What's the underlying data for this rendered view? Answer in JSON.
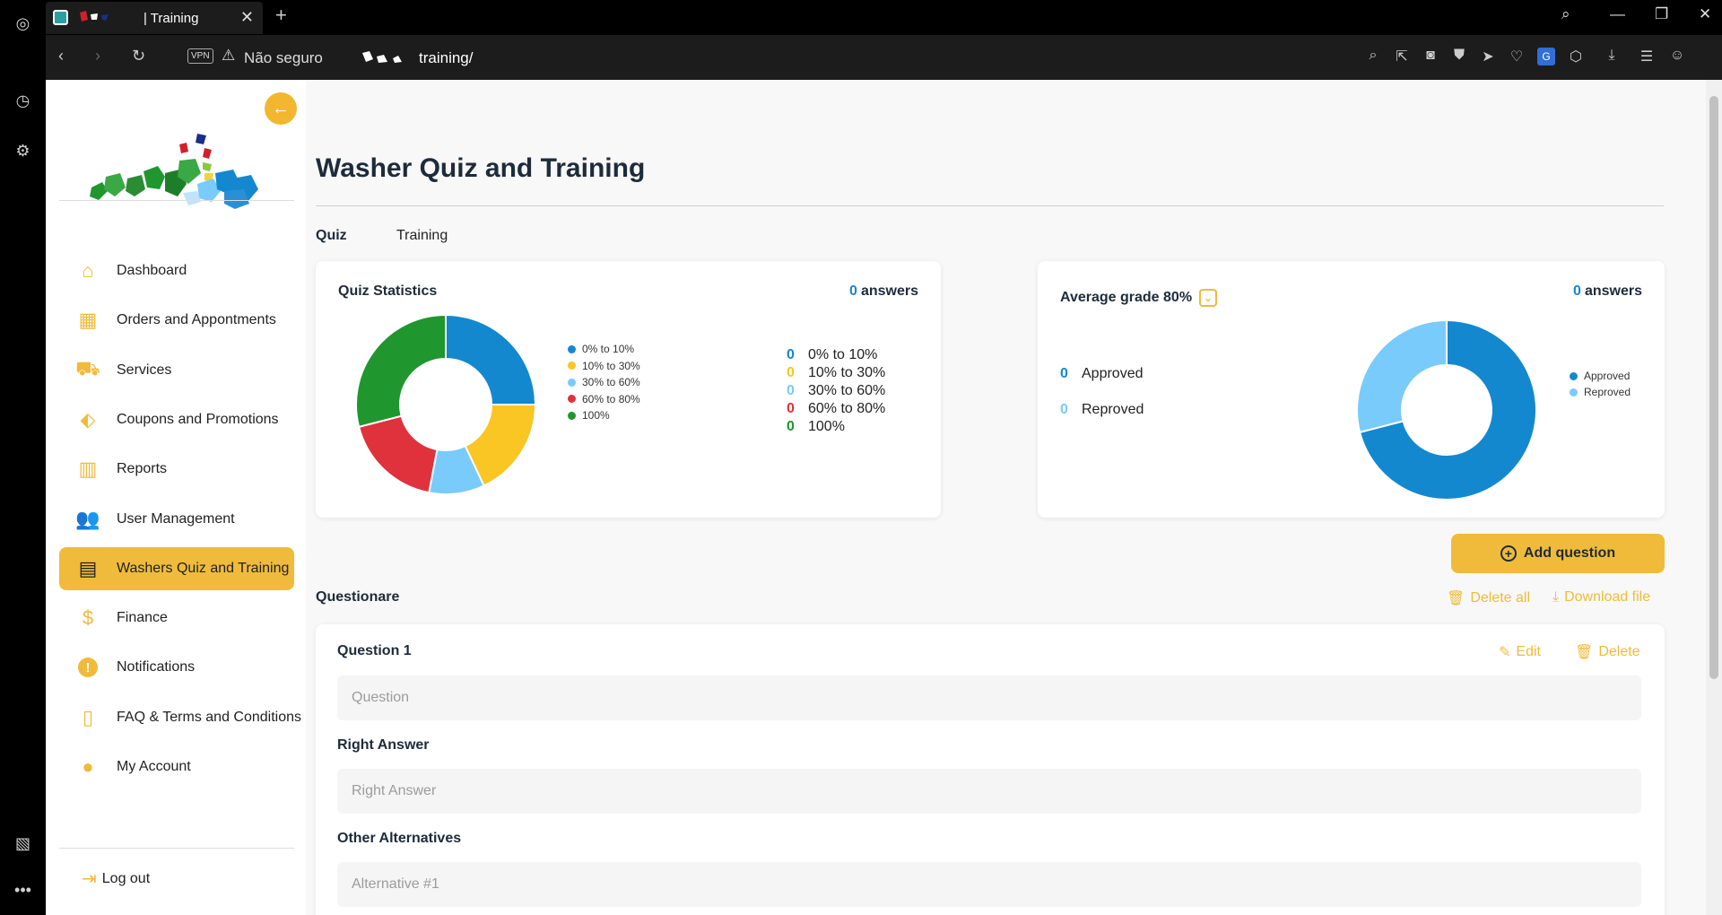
{
  "browser": {
    "tab_title": "| Training",
    "vpn_label": "VPN",
    "security_label": "Não seguro",
    "url": "training/"
  },
  "sidebar": {
    "items": [
      {
        "label": "Dashboard",
        "icon": "home-icon"
      },
      {
        "label": "Orders and Appontments",
        "icon": "calendar-icon"
      },
      {
        "label": "Services",
        "icon": "car-icon"
      },
      {
        "label": "Coupons and Promotions",
        "icon": "tag-icon"
      },
      {
        "label": "Reports",
        "icon": "reports-icon"
      },
      {
        "label": "User Management",
        "icon": "users-icon"
      },
      {
        "label": "Washers Quiz and Training",
        "icon": "document-icon"
      },
      {
        "label": "Finance",
        "icon": "dollar-icon"
      },
      {
        "label": "Notifications",
        "icon": "alert-icon"
      },
      {
        "label": "FAQ & Terms and Conditions",
        "icon": "file-icon"
      },
      {
        "label": "My Account",
        "icon": "user-icon"
      }
    ],
    "logout_label": "Log out"
  },
  "main": {
    "title": "Washer Quiz and Training",
    "tabs": [
      "Quiz",
      "Training"
    ],
    "quiz_stats": {
      "title": "Quiz Statistics",
      "answers_count": "0",
      "answers_label": "answers",
      "counts": [
        {
          "n": "0",
          "label": "0% to 10%"
        },
        {
          "n": "0",
          "label": "10% to 30%"
        },
        {
          "n": "0",
          "label": "30% to 60%"
        },
        {
          "n": "0",
          "label": "60% to 80%"
        },
        {
          "n": "0",
          "label": "100%"
        }
      ]
    },
    "avg_grade": {
      "title": "Average grade 80%",
      "answers_count": "0",
      "answers_label": "answers",
      "counts": [
        {
          "n": "0",
          "label": "Approved"
        },
        {
          "n": "0",
          "label": "Reproved"
        }
      ]
    },
    "add_question_label": "Add question",
    "questionare_label": "Questionare",
    "delete_all_label": "Delete all",
    "download_file_label": "Download file",
    "question": {
      "title": "Question 1",
      "edit_label": "Edit",
      "delete_label": "Delete",
      "question_placeholder": "Question",
      "right_answer_label": "Right Answer",
      "right_answer_placeholder": "Right Answer",
      "other_alternatives_label": "Other Alternatives",
      "alternative_placeholder": "Alternative #1"
    }
  },
  "chart_data": [
    {
      "type": "pie",
      "categories": [
        "0% to 10%",
        "10% to 30%",
        "30% to 60%",
        "60% to 80%",
        "100%"
      ],
      "values": [
        25,
        18,
        10,
        18,
        29
      ],
      "colors": [
        "#1388cf",
        "#f9c623",
        "#79cbfb",
        "#e0323c",
        "#20962e"
      ],
      "legend": "right"
    },
    {
      "type": "pie",
      "categories": [
        "Approved",
        "Reproved"
      ],
      "values": [
        71,
        29
      ],
      "colors": [
        "#1388cf",
        "#79cbfb"
      ],
      "legend": "right"
    }
  ]
}
